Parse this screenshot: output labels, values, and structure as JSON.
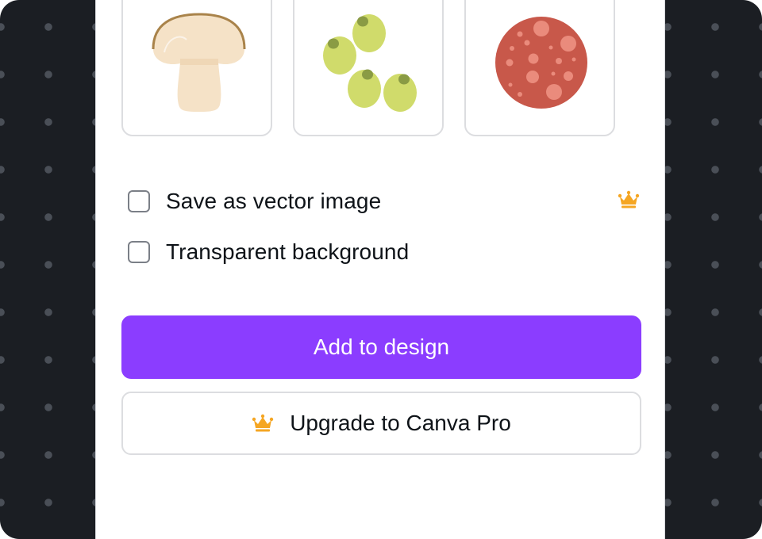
{
  "thumbnails": [
    {
      "icon": "mushroom-icon"
    },
    {
      "icon": "green-olives-icon"
    },
    {
      "icon": "pepperoni-icon"
    }
  ],
  "options": {
    "vector": {
      "label": "Save as vector image",
      "checked": false,
      "pro_icon": "crown-icon"
    },
    "transparent": {
      "label": "Transparent background",
      "checked": false
    }
  },
  "buttons": {
    "add_label": "Add to design",
    "upgrade_label": "Upgrade to Canva Pro",
    "upgrade_icon": "crown-icon"
  },
  "colors": {
    "primary": "#8b3dff",
    "crown": "#f5a623",
    "backdrop": "#1b1e23"
  }
}
